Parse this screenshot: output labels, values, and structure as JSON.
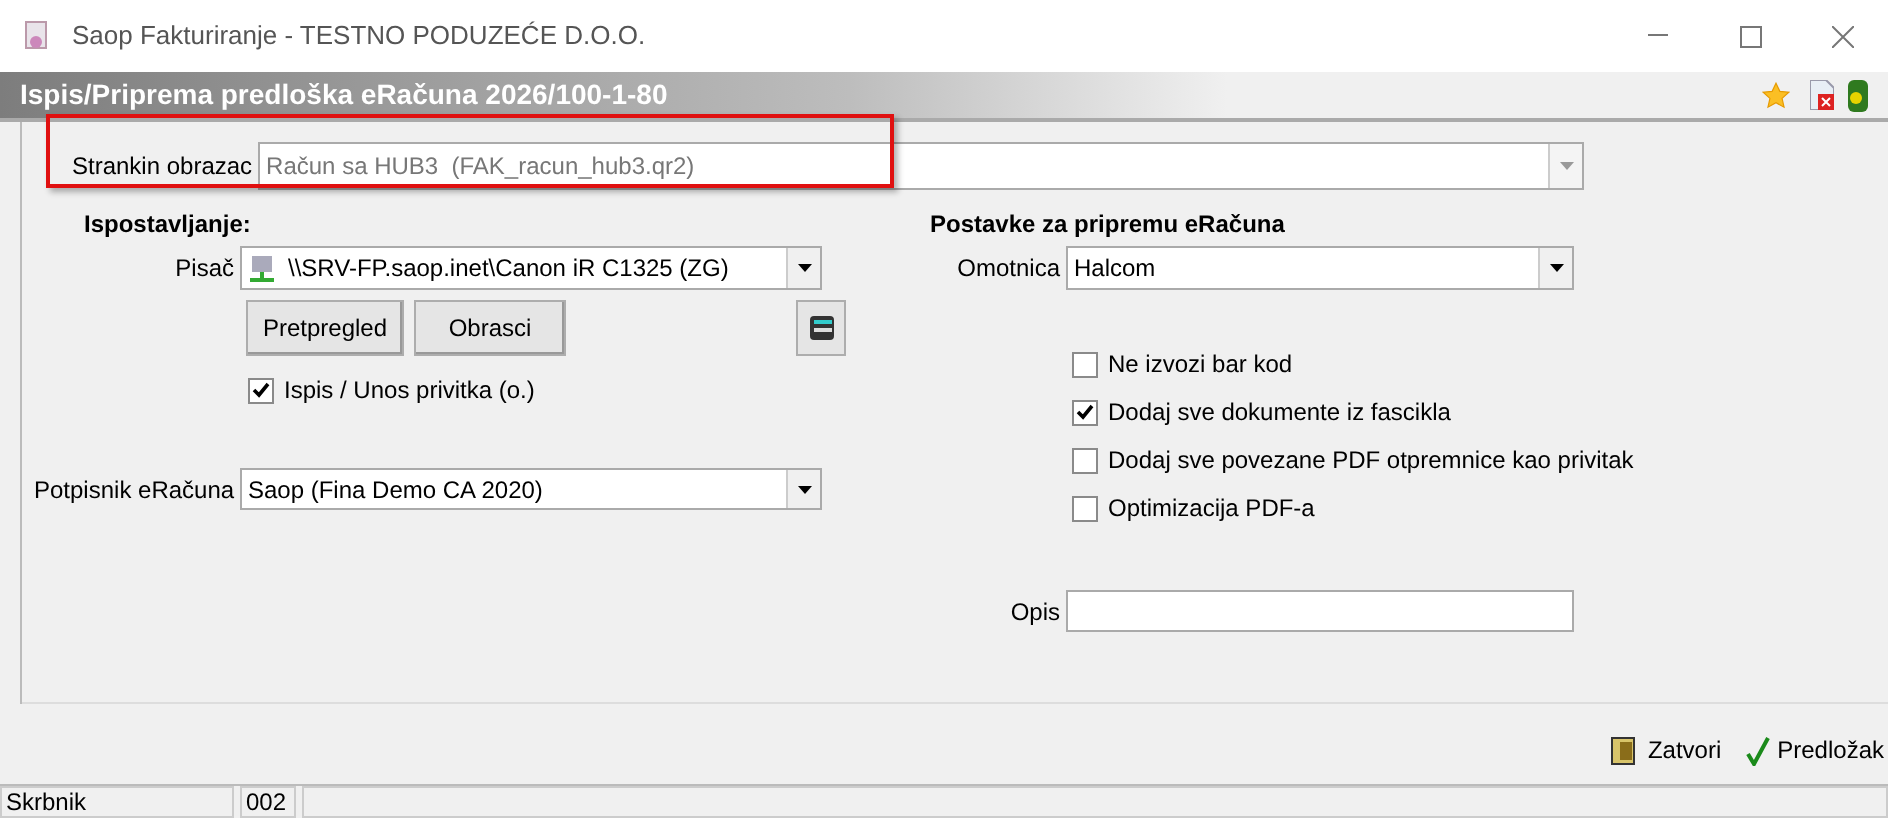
{
  "window": {
    "title": "Saop Fakturiranje - TESTNO PODUZEĆE D.O.O."
  },
  "header": {
    "title": "Ispis/Priprema predloška eRačuna 2026/100-1-80"
  },
  "client_form": {
    "label": "Strankin obrazac",
    "value": "Račun sa HUB3  (FAK_racun_hub3.qr2)",
    "highlighted": true
  },
  "issuing": {
    "title": "Ispostavljanje:",
    "printer_label": "Pisač",
    "printer": "\\\\SRV-FP.saop.inet\\Canon iR C1325 (ZG)",
    "buttons": [
      "Pretpregled",
      "Obrasci"
    ],
    "attachment": {
      "label": "Ispis / Unos privitka (o.)",
      "checked": true
    },
    "signer_label": "Potpisnik eRačuna",
    "signer": "Saop (Fina Demo CA 2020)"
  },
  "settings": {
    "title": "Postavke za pripremu eRačuna",
    "envelope_label": "Omotnica",
    "envelope": "Halcom",
    "options": [
      {
        "label": "Ne izvozi bar kod",
        "checked": false
      },
      {
        "label": "Dodaj sve dokumente iz fascikla",
        "checked": true
      },
      {
        "label": "Dodaj sve povezane PDF otpremnice kao privitak",
        "checked": false
      },
      {
        "label": "Optimizacija PDF-a",
        "checked": false
      }
    ],
    "description_label": "Opis"
  },
  "footer_buttons": [
    {
      "kind": "close",
      "label": "Zatvori"
    },
    {
      "kind": "template",
      "label": "Predložak"
    }
  ],
  "status_bar": [
    "Skrbnik",
    "002"
  ]
}
